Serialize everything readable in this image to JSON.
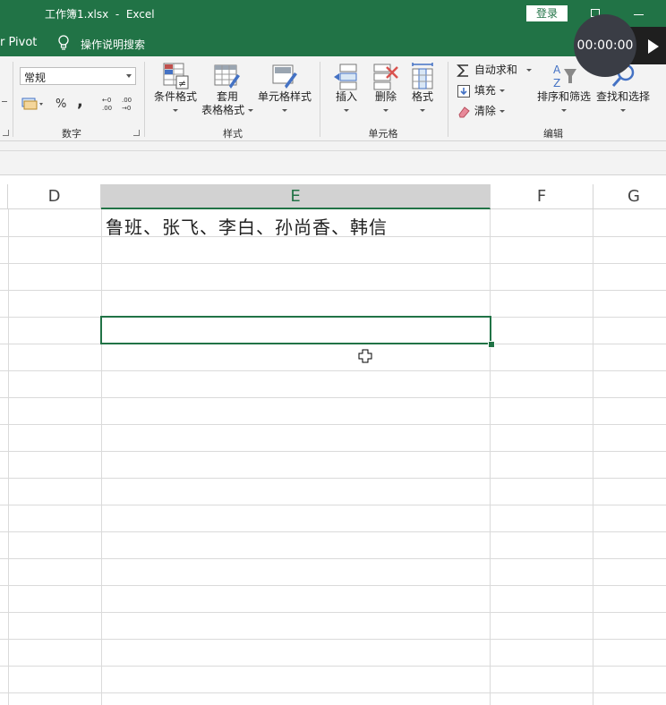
{
  "titlebar": {
    "title": "工作簿1.xlsx  -  Excel",
    "login_label": "登录"
  },
  "tellme": {
    "tab_partial": "r Pivot",
    "search_label": "操作说明搜索"
  },
  "recorder": {
    "time": "00:00:00"
  },
  "ribbon": {
    "number": {
      "format_value": "常规",
      "percent": "%",
      "comma": ",",
      "group_label": "数字"
    },
    "styles": {
      "conditional_label": "条件格式",
      "table_label_1": "套用",
      "table_label_2": "表格格式",
      "cell_style_label": "单元格样式",
      "group_label": "样式"
    },
    "cells": {
      "insert_label": "插入",
      "delete_label": "删除",
      "format_label": "格式",
      "group_label": "单元格"
    },
    "editing": {
      "autosum_label": "自动求和",
      "fill_label": "填充",
      "clear_label": "清除",
      "sort_label": "排序和筛选",
      "find_label": "查找和选择",
      "group_label": "编辑"
    }
  },
  "sheet": {
    "columns": [
      "D",
      "E",
      "F",
      "G"
    ],
    "selected_column": "E",
    "cell_E1": "鲁班、张飞、李白、孙尚香、韩信"
  }
}
